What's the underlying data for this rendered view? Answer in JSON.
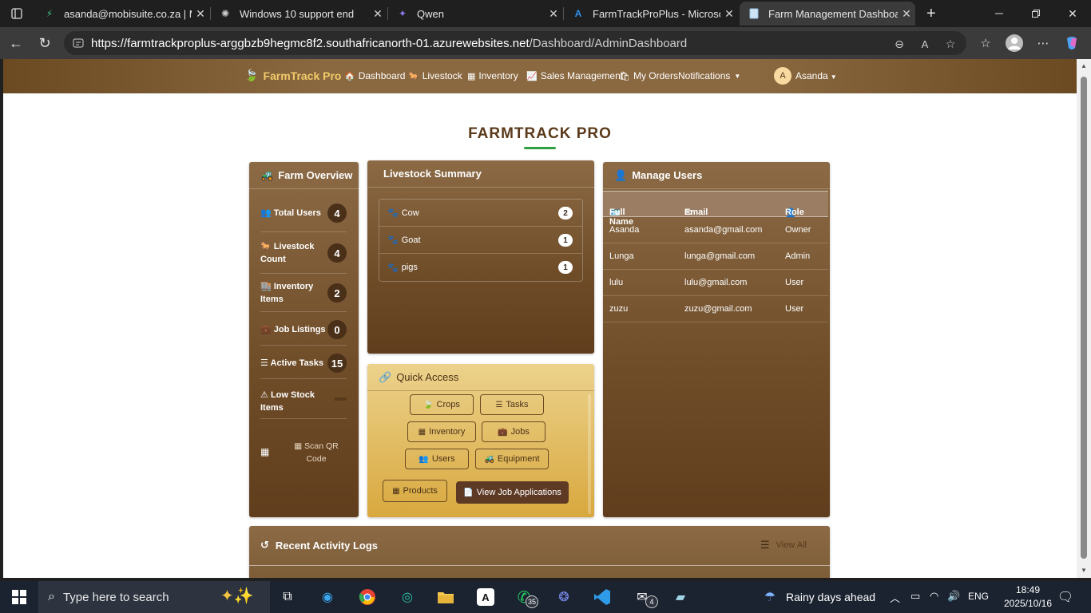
{
  "browser": {
    "tabs": [
      {
        "title": "asanda@mobisuite.co.za | Mo",
        "icon": "bolt-icon"
      },
      {
        "title": "Windows 10 support end",
        "icon": "openai-icon"
      },
      {
        "title": "Qwen",
        "icon": "qwen-icon"
      },
      {
        "title": "FarmTrackProPlus - Microsoft",
        "icon": "azure-icon"
      },
      {
        "title": "Farm Management Dashboard",
        "icon": "page-icon"
      }
    ],
    "url_host": "https://farmtrackproplus-arggbzb9hegmc8f2.southafricanorth-01.azurewebsites.net",
    "url_path": "/Dashboard/AdminDashboard"
  },
  "navbar": {
    "brand": "FarmTrack Pro",
    "links": [
      "Dashboard",
      "Livestock",
      "Inventory",
      "Sales Management",
      "My Orders",
      "Notifications"
    ],
    "avatar_initial": "A",
    "user_name": "Asanda"
  },
  "page": {
    "title": "FARMTRACK PRO"
  },
  "farm_overview": {
    "title": "Farm Overview",
    "rows": [
      {
        "label_1": "Total Users",
        "label_2": "",
        "value": "4"
      },
      {
        "label_1": "Livestock",
        "label_2": "Count",
        "value": "4"
      },
      {
        "label_1": "Inventory",
        "label_2": "Items",
        "value": "2"
      },
      {
        "label_1": "Job Listings",
        "label_2": "",
        "value": "0"
      },
      {
        "label_1": "Active Tasks",
        "label_2": "",
        "value": "15"
      },
      {
        "label_1": "Low Stock",
        "label_2": "Items",
        "value": ""
      }
    ],
    "scan_qr_1": "Scan QR",
    "scan_qr_2": "Code"
  },
  "livestock_summary": {
    "title": "Livestock Summary",
    "items": [
      {
        "name": "Cow",
        "count": "2"
      },
      {
        "name": "Goat",
        "count": "1"
      },
      {
        "name": "pigs",
        "count": "1"
      }
    ]
  },
  "quick_access": {
    "title": "Quick Access",
    "buttons": {
      "crops": "Crops",
      "tasks": "Tasks",
      "inventory": "Inventory",
      "jobs": "Jobs",
      "users": "Users",
      "equipment": "Equipment",
      "products": "Products",
      "job_applications": "View Job Applications"
    }
  },
  "manage_users": {
    "title": "Manage Users",
    "columns": [
      "Full Name",
      "Email",
      "Role"
    ],
    "rows": [
      {
        "name": "Asanda",
        "email": "asanda@gmail.com",
        "role": "Owner"
      },
      {
        "name": "Lunga",
        "email": "lunga@gmail.com",
        "role": "Admin"
      },
      {
        "name": "lulu",
        "email": "lulu@gmail.com",
        "role": "User"
      },
      {
        "name": "zuzu",
        "email": "zuzu@gmail.com",
        "role": "User"
      }
    ]
  },
  "activity_logs": {
    "title": "Recent Activity Logs",
    "view_all": "View All"
  },
  "taskbar": {
    "search_placeholder": "Type here to search",
    "whatsapp_badge": "35",
    "mail_badge": "4",
    "weather": "Rainy days ahead",
    "language": "ENG",
    "time": "18:49",
    "date": "2025/10/16"
  }
}
